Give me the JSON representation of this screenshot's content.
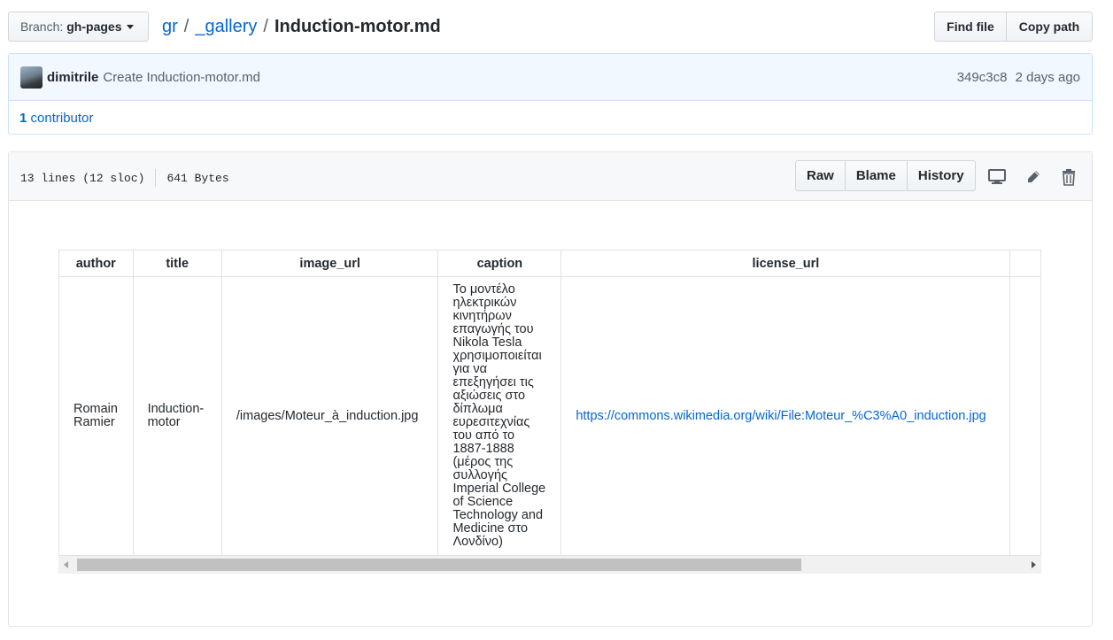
{
  "branch": {
    "prefix": "Branch:",
    "name": "gh-pages"
  },
  "breadcrumb": {
    "root": "gr",
    "sep1": "/",
    "folder": "_gallery",
    "sep2": "/",
    "file": "Induction-motor.md"
  },
  "toolbar": {
    "find_file": "Find file",
    "copy_path": "Copy path"
  },
  "commit": {
    "author": "dimitrile",
    "message": "Create Induction-motor.md",
    "sha": "349c3c8",
    "time": "2 days ago"
  },
  "contributors": {
    "count": "1",
    "label": "contributor"
  },
  "file": {
    "lines": "13 lines (12 sloc)",
    "size": "641 Bytes",
    "actions": {
      "raw": "Raw",
      "blame": "Blame",
      "history": "History"
    },
    "icons": [
      "desktop-icon",
      "pencil-icon",
      "trash-icon"
    ]
  },
  "table": {
    "headers": {
      "author": "author",
      "title": "title",
      "image_url": "image_url",
      "caption": "caption",
      "license_url": "license_url"
    },
    "row": {
      "author": "Romain Ramier",
      "title": "Induction-motor",
      "image_url": "/images/Moteur_à_induction.jpg",
      "caption": "Το μοντέλο ηλεκτρικών κινητήρων επαγωγής του Nikola Tesla χρησιμοποιείται για να επεξηγήσει τις αξιώσεις στο δίπλωμα ευρεσιτεχνίας του από το 1887-1888 (μέρος της συλλογής Imperial College of Science Technology and Medicine στο Λονδίνο)",
      "license_url": "https://commons.wikimedia.org/wiki/File:Moteur_%C3%A0_induction.jpg"
    }
  },
  "colors": {
    "link": "#0366d6",
    "commit_bg": "#f1f8ff",
    "commit_border": "#c8e1ff"
  }
}
